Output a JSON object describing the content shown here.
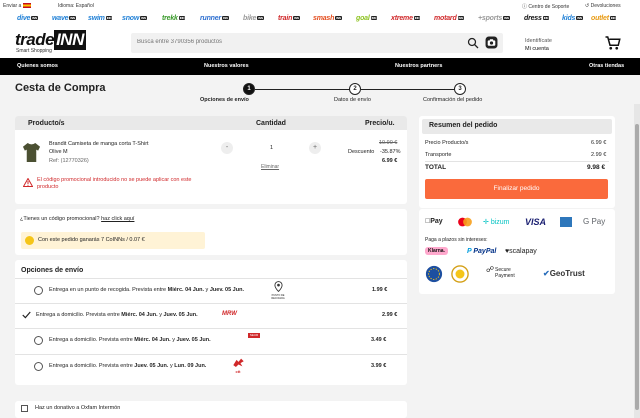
{
  "topbar": {
    "ship_to": "Enviar a",
    "language": "Idioma: Español",
    "support": "Centro de Soporte",
    "returns": "Devoluciones"
  },
  "stores": [
    {
      "name": "dive",
      "color": "#1e7fd6"
    },
    {
      "name": "wave",
      "color": "#1e7fd6"
    },
    {
      "name": "swim",
      "color": "#1e7fd6"
    },
    {
      "name": "snow",
      "color": "#1e7fd6"
    },
    {
      "name": "trekk",
      "color": "#3a9a2b"
    },
    {
      "name": "runner",
      "color": "#2d6fd0"
    },
    {
      "name": "bike",
      "color": "#999999"
    },
    {
      "name": "train",
      "color": "#d0282a"
    },
    {
      "name": "smash",
      "color": "#e44d1e"
    },
    {
      "name": "goal",
      "color": "#8cc21f"
    },
    {
      "name": "xtreme",
      "color": "#d0282a"
    },
    {
      "name": "motard",
      "color": "#d0282a"
    },
    {
      "name": "+sports",
      "color": "#999999"
    },
    {
      "name": "dress",
      "color": "#111111"
    },
    {
      "name": "kids",
      "color": "#1e7fd6"
    },
    {
      "name": "outlet",
      "color": "#e89a12"
    }
  ],
  "store_tag": "INN",
  "header": {
    "logo_main": "trade",
    "logo_box": "INN",
    "logo_sub": "Smart Shopping",
    "search_placeholder": "Busca entre 3790356 productos",
    "account_line1": "Identifícate",
    "account_line2": "Mi cuenta"
  },
  "nav": [
    "Quienes somos",
    "Nuestros valores",
    "Nuestros partners",
    "Otras tiendas"
  ],
  "page_title": "Cesta de Compra",
  "steps": [
    {
      "num": "1",
      "label": "Opciones de envío"
    },
    {
      "num": "2",
      "label": "Datos de envío"
    },
    {
      "num": "3",
      "label": "Confirmación del pedido"
    }
  ],
  "cart": {
    "col_product": "Producto/s",
    "col_qty": "Cantidad",
    "col_price": "Precio/u.",
    "item": {
      "name": "Brandit Camiseta de manga corta T-Shirt",
      "variant": "Olive M",
      "ref": "Ref: (12770326)",
      "qty": "1",
      "remove": "Eliminar",
      "old_price": "10.90 €",
      "discount_label": "Descuento",
      "discount": "-35.87%",
      "price": "6.99 €"
    },
    "promo_error": "El código promocional introducido no se puede aplicar con este producto",
    "minus": "-",
    "plus": "+"
  },
  "promo": {
    "question": "¿Tienes un código promocional?",
    "link": "haz click aquí",
    "coins": "Con este pedido ganarás 7 CoINNs / 0.07 €"
  },
  "shipping": {
    "title": "Opciones de envío",
    "options": [
      {
        "text_pre": "Entrega en un punto de recogida. Prevista entre ",
        "d1": "Miérc. 04 Jun.",
        "mid": " y ",
        "d2": "Juev. 05 Jun.",
        "carrier": "PUNTO DE RECOGIDA",
        "price": "1.99 €",
        "selected": false
      },
      {
        "text_pre": "Entrega a domicilio. Prevista entre ",
        "d1": "Miérc. 04 Jun.",
        "mid": " y ",
        "d2": "Juev. 05 Jun.",
        "carrier": "MRW",
        "price": "2.99 €",
        "selected": true
      },
      {
        "text_pre": "Entrega a domicilio. Prevista entre ",
        "d1": "Miérc. 04 Jun.",
        "mid": " y ",
        "d2": "Juev. 05 Jun.",
        "carrier": "SEUR",
        "price": "3.49 €",
        "selected": false
      },
      {
        "text_pre": "Entrega a domicilio. Prevista entre ",
        "d1": "Juev. 05 Jun.",
        "mid": " y ",
        "d2": "Lun. 09 Jun.",
        "carrier": "ctt",
        "price": "3.99 €",
        "selected": false
      }
    ],
    "gift_label": "Haz un donativo a Oxfam Intermón"
  },
  "summary": {
    "title": "Resumen del pedido",
    "products_label": "Precio Producto/s",
    "products_value": "6.99 €",
    "shipping_label": "Transporte",
    "shipping_value": "2.99 €",
    "total_label": "TOTAL",
    "total_value": "9.98 €",
    "finalize": "Finalizar pedido",
    "installments": "Paga a plazos sin intereses:",
    "pay_methods": [
      "Pay",
      "bizum",
      "VISA",
      "G Pay"
    ],
    "bnpl": [
      "Klarna.",
      "PayPal",
      "scalapay"
    ],
    "trust": [
      "Secure Payment",
      "GeoTrust"
    ]
  },
  "colors": {
    "accent": "#fa6a3c",
    "error": "#d0282a",
    "coin_bg": "#fff3d6"
  }
}
